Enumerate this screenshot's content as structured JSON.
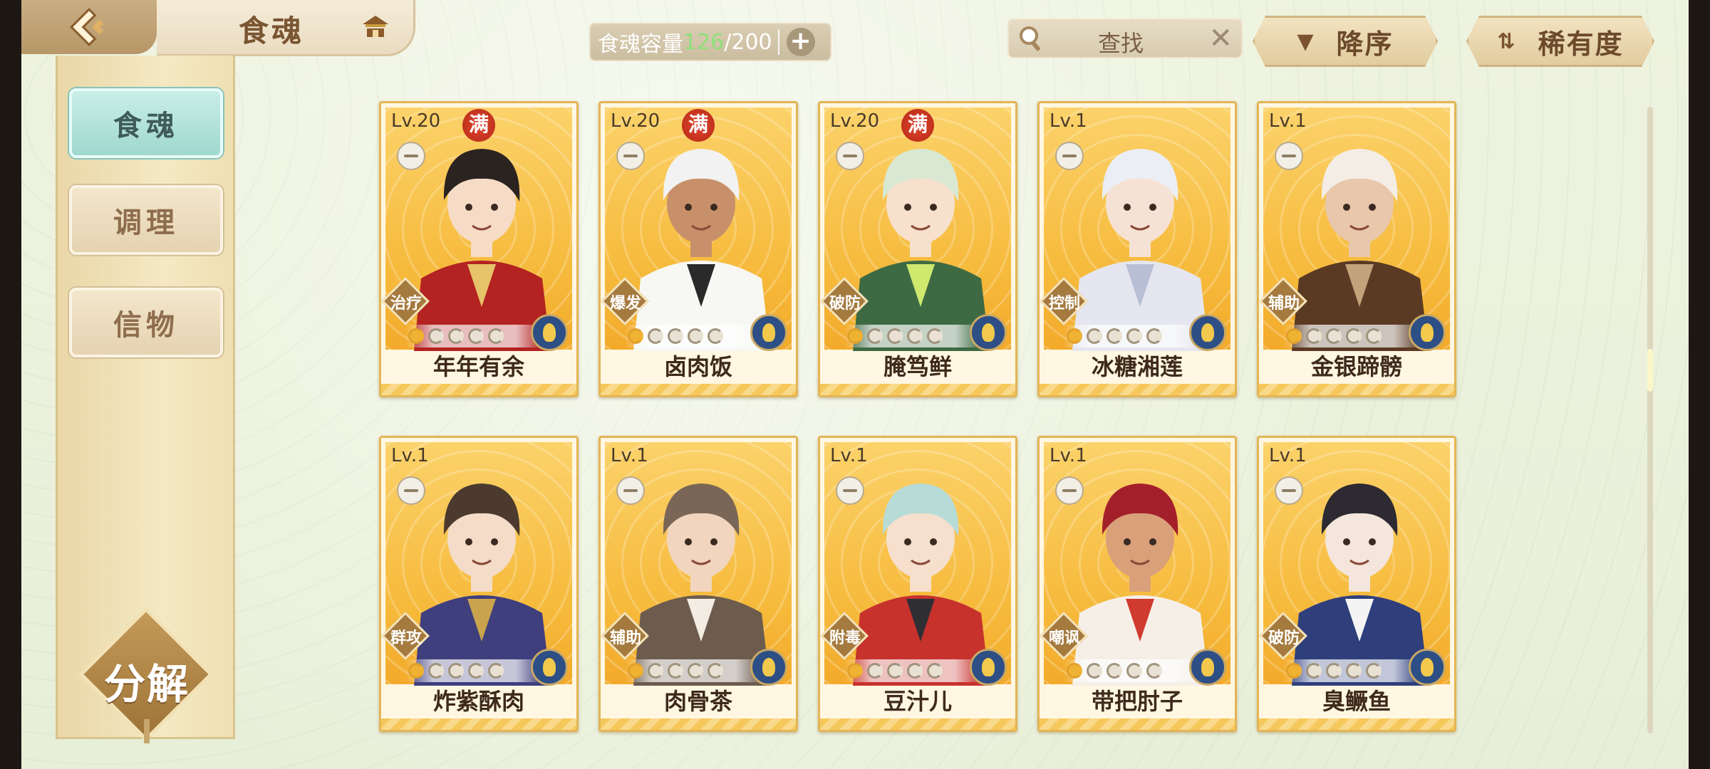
{
  "header": {
    "title": "食魂",
    "capacity": {
      "label": "食魂容量",
      "current": "126",
      "total": "/200"
    },
    "search": {
      "text": "查找"
    },
    "sort_order_label": "降序",
    "sort_rarity_label": "稀有度"
  },
  "sidebar": {
    "items": [
      {
        "label": "食魂",
        "active": true
      },
      {
        "label": "调理",
        "active": false
      },
      {
        "label": "信物",
        "active": false
      }
    ],
    "decompose_label": "分解"
  },
  "cards": [
    {
      "lv": "Lv.20",
      "maxed": "满",
      "role": "治疗",
      "name": "年年有余",
      "hair": "#2b2320",
      "outfit": "#b32322",
      "accent": "#e7c36a",
      "skin": "#f6dcc6"
    },
    {
      "lv": "Lv.20",
      "maxed": "满",
      "role": "爆发",
      "name": "卤肉饭",
      "hair": "#f2f2f2",
      "outfit": "#f7f7f4",
      "accent": "#2a2a2a",
      "skin": "#c8906a"
    },
    {
      "lv": "Lv.20",
      "maxed": "满",
      "role": "破防",
      "name": "腌笃鲜",
      "hair": "#d9e8d2",
      "outfit": "#3e6a43",
      "accent": "#cfe86e",
      "skin": "#f7e0cc"
    },
    {
      "lv": "Lv.1",
      "maxed": "",
      "role": "控制",
      "name": "冰糖湘莲",
      "hair": "#eceef5",
      "outfit": "#e5e6ef",
      "accent": "#b8bfd6",
      "skin": "#f6e2d4"
    },
    {
      "lv": "Lv.1",
      "maxed": "",
      "role": "辅助",
      "name": "金银蹄髈",
      "hair": "#f4ede6",
      "outfit": "#5b3a24",
      "accent": "#c2a27a",
      "skin": "#e9c7ab"
    },
    {
      "lv": "Lv.1",
      "maxed": "",
      "role": "群攻",
      "name": "炸紫酥肉",
      "hair": "#4c3a2e",
      "outfit": "#3f3f7e",
      "accent": "#c9a34e",
      "skin": "#f5dcc8"
    },
    {
      "lv": "Lv.1",
      "maxed": "",
      "role": "辅助",
      "name": "肉骨茶",
      "hair": "#7a6656",
      "outfit": "#6d5c4e",
      "accent": "#f2ece2",
      "skin": "#f1d5bf"
    },
    {
      "lv": "Lv.1",
      "maxed": "",
      "role": "附毒",
      "name": "豆汁儿",
      "hair": "#b7dcd8",
      "outfit": "#c7322d",
      "accent": "#2f2f33",
      "skin": "#f6dfcd"
    },
    {
      "lv": "Lv.1",
      "maxed": "",
      "role": "嘲讽",
      "name": "带把肘子",
      "hair": "#a3202a",
      "outfit": "#f5efe8",
      "accent": "#d13a2e",
      "skin": "#d9a07a"
    },
    {
      "lv": "Lv.1",
      "maxed": "",
      "role": "破防",
      "name": "臭鳜鱼",
      "hair": "#2e2a32",
      "outfit": "#2f3f7c",
      "accent": "#f4f4f4",
      "skin": "#f4e6dc"
    }
  ],
  "colors": {
    "background": "#eaf0d9",
    "card_border": "#e3b556",
    "active_tab": "#a7dcd2"
  },
  "icons": [
    "back-arrow-icon",
    "house-icon",
    "plus-icon",
    "search-icon",
    "close-icon",
    "sort-down-icon",
    "sort-swap-icon",
    "element-emblem-icon"
  ]
}
